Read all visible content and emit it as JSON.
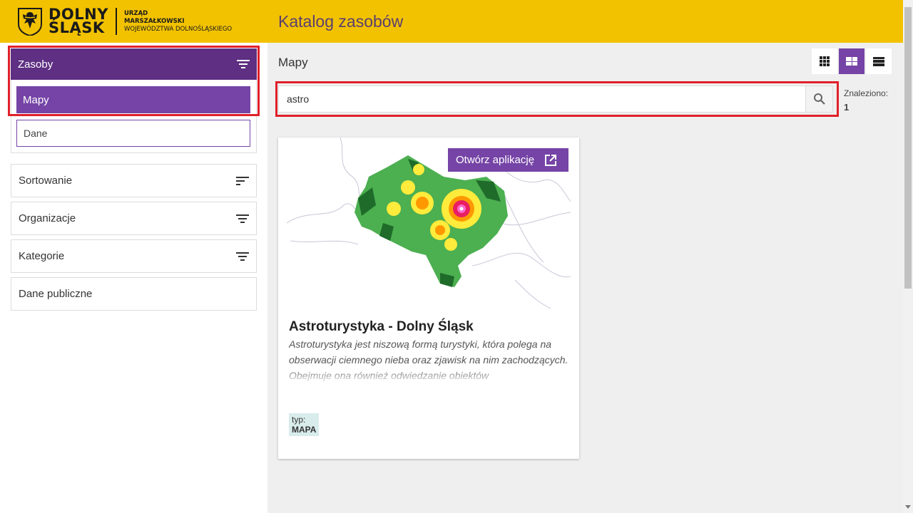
{
  "header": {
    "brand_line1": "DOLNY",
    "brand_line2": "ŚLĄSK",
    "office_line1": "URZĄD",
    "office_line2": "MARSZAŁKOWSKI",
    "office_line3": "WOJEWÓDZTWA DOLNOŚLĄSKIEGO",
    "app_title": "Katalog zasobów",
    "accent_color": "#f2c200"
  },
  "sidebar": {
    "zasoby_label": "Zasoby",
    "mapy_label": "Mapy",
    "dane_label": "Dane",
    "sortowanie_label": "Sortowanie",
    "organizacje_label": "Organizacje",
    "kategorie_label": "Kategorie",
    "dane_publiczne_label": "Dane publiczne",
    "primary_color": "#5e2f82"
  },
  "main": {
    "section_title": "Mapy",
    "search_value": "astro",
    "found_label": "Znaleziono:",
    "found_count": "1",
    "view_modes": [
      "grid-small",
      "grid-large",
      "list"
    ],
    "active_view": "grid-large"
  },
  "card": {
    "open_button_label": "Otwórz aplikację",
    "title": "Astroturystyka - Dolny Śląsk",
    "description": "Astroturystyka jest niszową formą turystyki, która polega na obserwacji ciemnego nieba oraz zjawisk na nim zachodzących. Obejmuje ona również odwiedzanie obiektów",
    "type_label": "typ:",
    "type_value": "MAPA"
  }
}
